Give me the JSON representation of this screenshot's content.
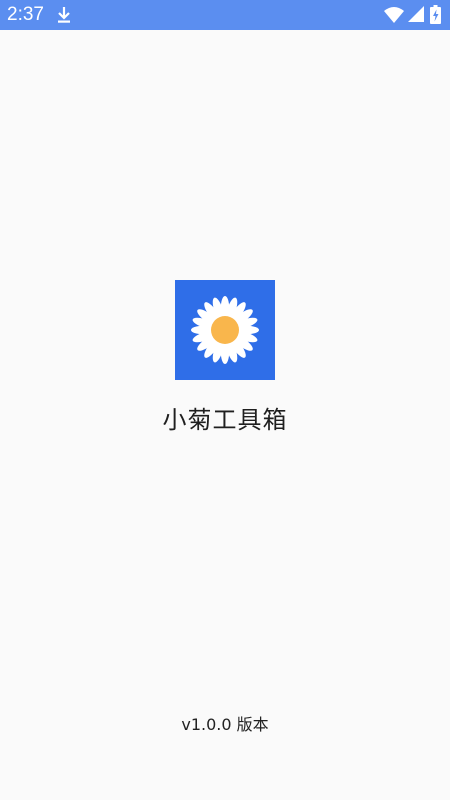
{
  "status_bar": {
    "time": "2:37",
    "background": "#5b8ef0",
    "icons": [
      "download-icon",
      "wifi-icon",
      "signal-icon",
      "battery-icon"
    ]
  },
  "splash": {
    "logo_icon": "daisy-icon",
    "logo_background": "#2f6ee8",
    "petal_color": "#ffffff",
    "center_color": "#f9b64c",
    "app_name": "小菊工具箱",
    "version": "v1.0.0 版本"
  }
}
